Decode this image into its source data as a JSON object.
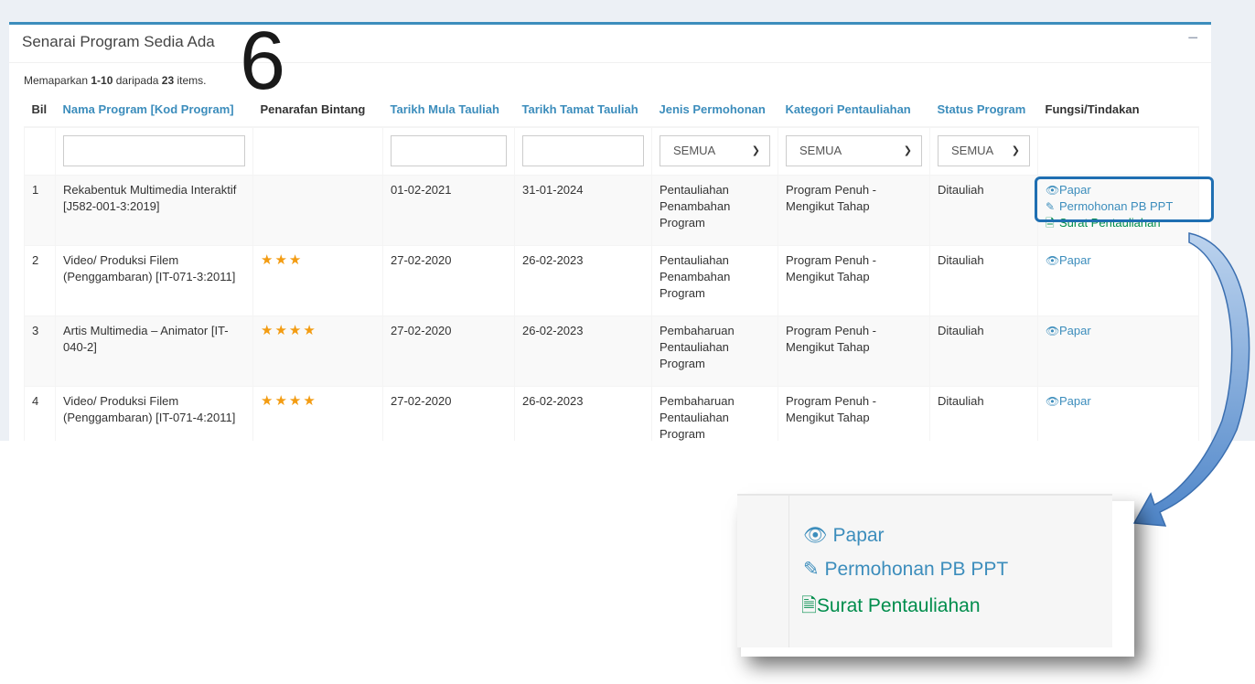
{
  "panel": {
    "title": "Senarai Program Sedia Ada",
    "collapse_symbol": "−",
    "annotation": "6"
  },
  "summary": {
    "prefix": "Memaparkan ",
    "range": "1-10",
    "middle": " daripada ",
    "total": "23",
    "suffix": " items."
  },
  "table": {
    "headers": [
      "Bil",
      "Nama Program [Kod Program]",
      "Penarafan Bintang",
      "Tarikh Mula Tauliah",
      "Tarikh Tamat Tauliah",
      "Jenis Permohonan",
      "Kategori Pentauliahan",
      "Status Program",
      "Fungsi/Tindakan"
    ],
    "filters": {
      "jenis": "SEMUA",
      "kategori": "SEMUA",
      "status": "SEMUA"
    },
    "rows": [
      {
        "bil": "1",
        "nama": "Rekabentuk Multimedia Interaktif [J582-001-3:2019]",
        "stars": 0,
        "mula": "01-02-2021",
        "tamat": "31-01-2024",
        "jenis": "Pentauliahan Penambahan Program",
        "kategori": "Program Penuh - Mengikut Tahap",
        "status": "Ditauliah"
      },
      {
        "bil": "2",
        "nama": "Video/ Produksi Filem (Penggambaran) [IT-071-3:2011]",
        "stars": 3,
        "mula": "27-02-2020",
        "tamat": "26-02-2023",
        "jenis": "Pentauliahan Penambahan Program",
        "kategori": "Program Penuh - Mengikut Tahap",
        "status": "Ditauliah"
      },
      {
        "bil": "3",
        "nama": "Artis Multimedia – Animator [IT-040-2]",
        "stars": 4,
        "mula": "27-02-2020",
        "tamat": "26-02-2023",
        "jenis": "Pembaharuan Pentauliahan Program",
        "kategori": "Program Penuh - Mengikut Tahap",
        "status": "Ditauliah"
      },
      {
        "bil": "4",
        "nama": "Video/ Produksi Filem (Penggambaran) [IT-071-4:2011]",
        "stars": 4,
        "mula": "27-02-2020",
        "tamat": "26-02-2023",
        "jenis": "Pembaharuan Pentauliahan Program",
        "kategori": "Program Penuh - Mengikut Tahap",
        "status": "Ditauliah"
      }
    ]
  },
  "actions": {
    "papar": "Papar",
    "permohonan": "Permohonan PB PPT",
    "surat": "Surat Pentauliahan"
  },
  "icons": {
    "view": "eye-icon",
    "edit": "pencil-icon",
    "doc": "document-icon"
  },
  "colors": {
    "link": "#3c8dbc",
    "green": "#008d4c",
    "star": "#f39c12",
    "highlight": "#1f6fb2"
  }
}
